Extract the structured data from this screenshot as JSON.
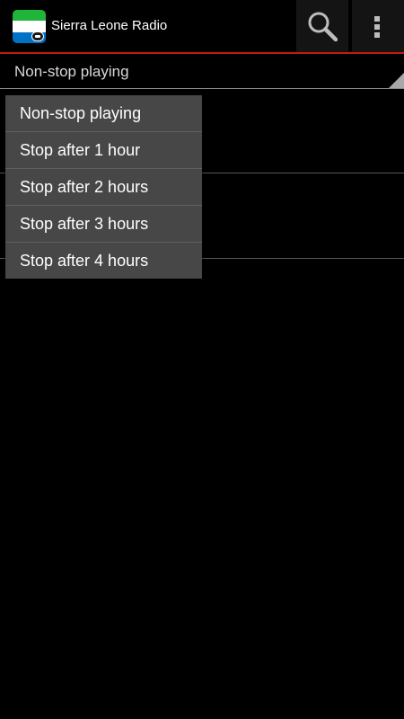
{
  "app": {
    "title": "Sierra Leone Radio",
    "icon": "sierra-leone-flag-radio-icon",
    "flag_colors": [
      "#1eb53a",
      "#ffffff",
      "#0072c6"
    ],
    "accent_color": "#c81818"
  },
  "actions": {
    "search_icon": "search-icon",
    "overflow_icon": "overflow-menu-icon"
  },
  "spinner": {
    "selected": "Non-stop playing"
  },
  "dropdown": {
    "options": [
      "Non-stop playing",
      "Stop after 1 hour",
      "Stop after 2 hours",
      "Stop after 3 hours",
      "Stop after 4 hours"
    ]
  }
}
